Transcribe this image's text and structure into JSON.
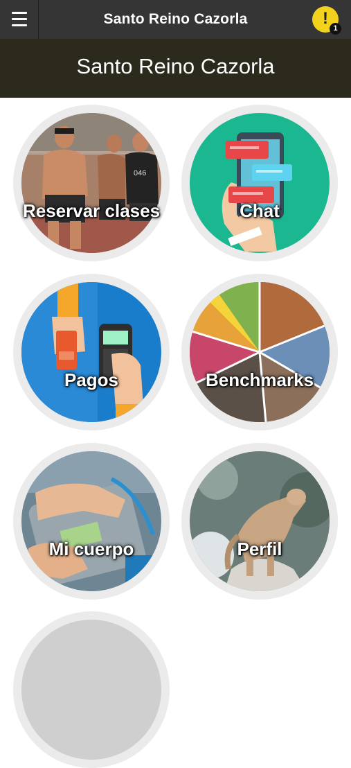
{
  "topbar": {
    "title": "Santo Reino Cazorla",
    "menu_icon": "hamburger-menu-icon",
    "alert_icon": "exclamation-icon",
    "alert_count": "1",
    "colors": {
      "bar": "#353535",
      "alert": "#f2d21c"
    }
  },
  "banner": {
    "title": "Santo Reino Cazorla",
    "color": "#2c2a1c"
  },
  "tiles": [
    {
      "label": "Reservar clases",
      "image": "athletes-running-photo"
    },
    {
      "label": "Chat",
      "image": "phone-chat-illustration",
      "color": "#1bb791"
    },
    {
      "label": "Pagos",
      "image": "card-payment-illustration",
      "color": "#1a7dcc"
    },
    {
      "label": "Benchmarks",
      "image": "sports-collage-photo"
    },
    {
      "label": "Mi cuerpo",
      "image": "bathroom-scale-photo"
    },
    {
      "label": "Perfil",
      "image": "puma-photo"
    }
  ]
}
